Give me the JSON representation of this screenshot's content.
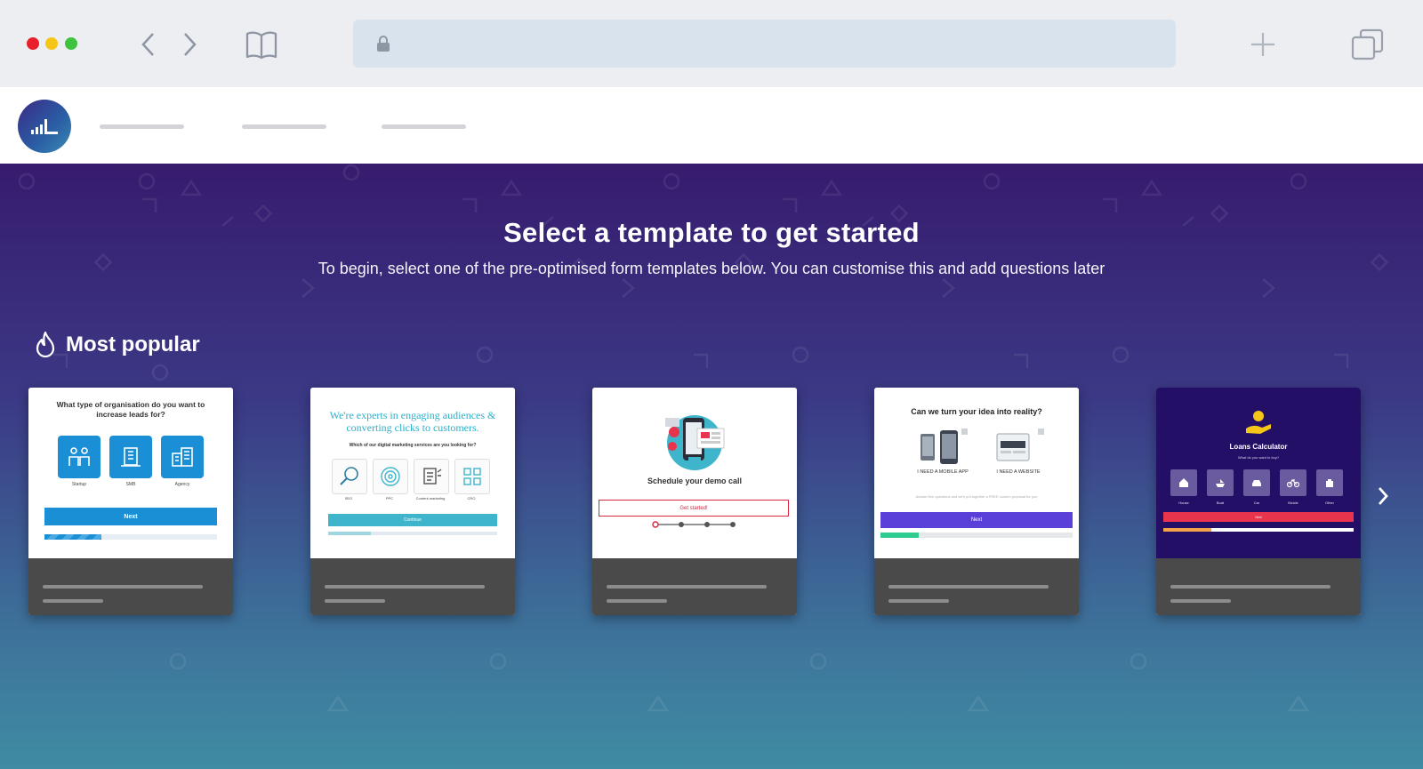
{
  "browser": {
    "icons": [
      "back-icon",
      "forward-icon",
      "bookmarks-icon",
      "lock-icon",
      "new-tab-icon",
      "tabs-icon"
    ]
  },
  "header": {
    "logo_icon": "bar-chart-icon"
  },
  "hero": {
    "title": "Select a template to get started",
    "subtitle": "To begin, select one of the pre-optimised form templates below. You can customise this and add questions later",
    "section_label": "Most popular",
    "section_icon": "flame-icon"
  },
  "templates": [
    {
      "question": "What type of organisation do you want to increase leads for?",
      "options": [
        "Startup",
        "SMB",
        "Agency"
      ],
      "button": "Next",
      "progress": 0.33,
      "accent": "#1a8fd6"
    },
    {
      "heading": "We're experts in engaging audiences & converting clicks to customers.",
      "question": "Which of our digital marketing services are you looking for?",
      "options": [
        "SEO",
        "PPC",
        "Content marketing",
        "CRO"
      ],
      "button": "Continue",
      "progress": 0.25,
      "accent": "#3fb5cc"
    },
    {
      "title": "Schedule your demo call",
      "button": "Get started!",
      "steps": 4,
      "current_step": 1,
      "accent": "#d7263d"
    },
    {
      "question": "Can we turn your idea into reality?",
      "options": [
        "I NEED A MOBILE APP",
        "I NEED A WEBSITE"
      ],
      "fine_print": "Answer five questions and we'll put together a FREE custom proposal for you",
      "button": "Next",
      "progress": 0.2,
      "accent": "#5b3fd9"
    },
    {
      "title": "Loans Calculator",
      "question": "What do you want to buy?",
      "options": [
        "House",
        "Boat",
        "Car",
        "Bicicle",
        "Other"
      ],
      "button": "Next",
      "progress": 0.25,
      "accent": "#e8354d"
    }
  ]
}
